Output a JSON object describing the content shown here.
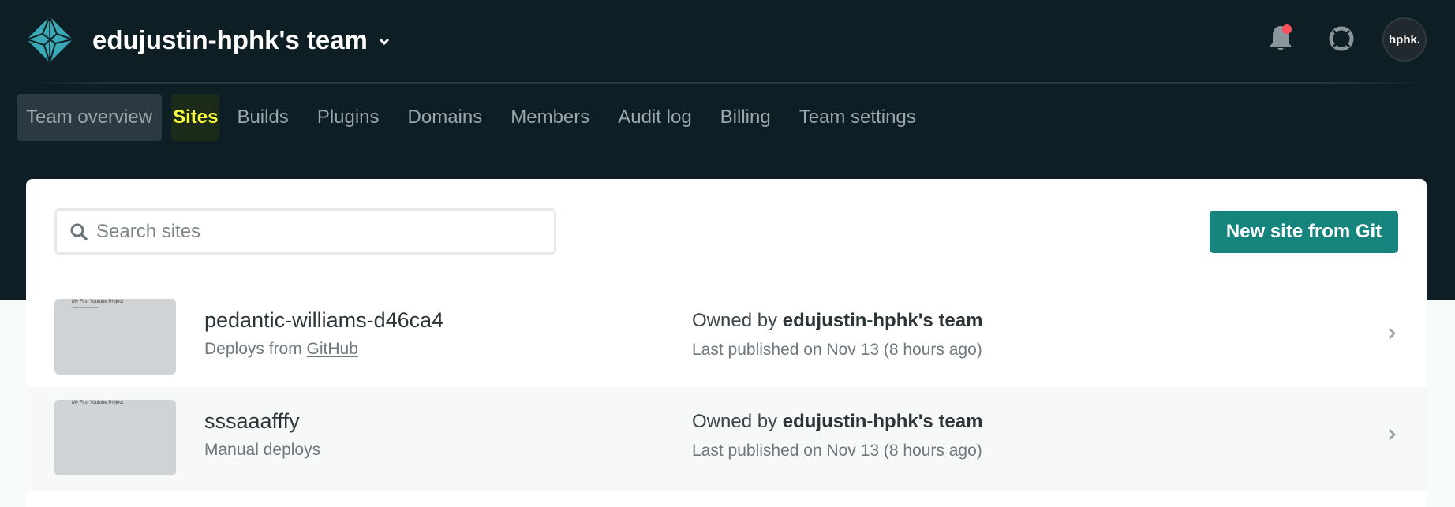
{
  "header": {
    "team_name": "edujustin-hphk's team",
    "avatar_initials": "hphk."
  },
  "nav": {
    "items": [
      {
        "label": "Team overview"
      },
      {
        "label": "Sites"
      },
      {
        "label": "Builds"
      },
      {
        "label": "Plugins"
      },
      {
        "label": "Domains"
      },
      {
        "label": "Members"
      },
      {
        "label": "Audit log"
      },
      {
        "label": "Billing"
      },
      {
        "label": "Team settings"
      }
    ]
  },
  "search": {
    "placeholder": "Search sites"
  },
  "new_site_button": "New site from Git",
  "sites": [
    {
      "name": "pedantic-williams-d46ca4",
      "deploy_prefix": "Deploys from ",
      "deploy_link": "GitHub",
      "owned_by_prefix": "Owned by ",
      "owner": "edujustin-hphk's team",
      "published": "Last published on Nov 13 (8 hours ago)",
      "thumb_title": "My First Youtube Project"
    },
    {
      "name": "sssaaafffy",
      "deploy_prefix": "Manual deploys",
      "owned_by_prefix": "Owned by ",
      "owner": "edujustin-hphk's team",
      "published": "Last published on Nov 13 (8 hours ago)",
      "thumb_title": "My First Youtube Project"
    }
  ],
  "colors": {
    "header_bg": "#0e1e25",
    "accent": "#15847d",
    "active_nav": "#fcff3b",
    "notification_dot": "#ff4d5a"
  }
}
